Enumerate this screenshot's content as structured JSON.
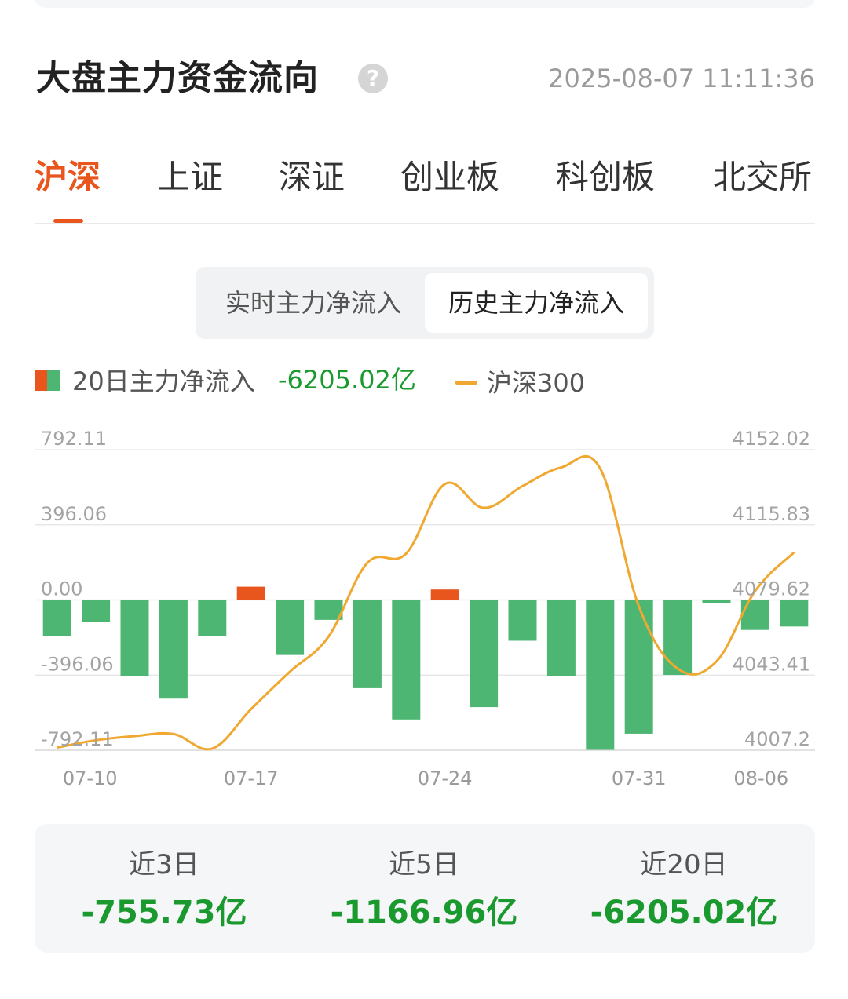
{
  "header": {
    "title": "大盘主力资金流向",
    "help_icon_glyph": "?",
    "timestamp": "2025-08-07 11:11:36"
  },
  "tabs": [
    {
      "label": "沪深",
      "active": true
    },
    {
      "label": "上证",
      "active": false
    },
    {
      "label": "深证",
      "active": false
    },
    {
      "label": "创业板",
      "active": false
    },
    {
      "label": "科创板",
      "active": false
    },
    {
      "label": "北交所",
      "active": false
    }
  ],
  "segmented": {
    "realtime_label": "实时主力净流入",
    "history_label": "历史主力净流入",
    "active": "history"
  },
  "legend": {
    "flow_label": "20日主力净流入",
    "flow_value": "-6205.02亿",
    "index_label": "沪深300"
  },
  "colors": {
    "inflow": "#e8561e",
    "outflow": "#4db673",
    "index_line": "#f0a830",
    "accent": "#e8561e",
    "positive_text_green": "#1a9a2e"
  },
  "chart_data": {
    "type": "bar+line",
    "x": [
      "07-10",
      "07-11",
      "07-14",
      "07-15",
      "07-16",
      "07-17",
      "07-18",
      "07-21",
      "07-22",
      "07-23",
      "07-24",
      "07-25",
      "07-28",
      "07-29",
      "07-30",
      "07-31",
      "08-01",
      "08-04",
      "08-05",
      "08-06"
    ],
    "x_tick_labels": [
      "07-10",
      "07-17",
      "07-24",
      "07-31",
      "08-06"
    ],
    "series": [
      {
        "name": "20日主力净流入",
        "axis": "left",
        "kind": "bar",
        "values": [
          -190,
          -115,
          -400,
          -520,
          -190,
          70,
          -290,
          -105,
          -465,
          -630,
          55,
          -565,
          -215,
          -400,
          -790,
          -705,
          -395,
          -15,
          -158,
          -140
        ]
      },
      {
        "name": "沪深300",
        "axis": "right",
        "kind": "line",
        "values": [
          4008.5,
          4012.0,
          4014.0,
          4015.0,
          4008.0,
          4027.0,
          4045.0,
          4062.0,
          4097.5,
          4102.0,
          4135.5,
          4124.0,
          4134.5,
          4143.5,
          4143.0,
          4076.5,
          4046.5,
          4050.0,
          4084.0,
          4102.5
        ]
      }
    ],
    "left_axis": {
      "ticks": [
        "792.11",
        "396.06",
        "0.00",
        "-396.06",
        "-792.11"
      ],
      "ylim": [
        -792.11,
        792.11
      ]
    },
    "right_axis": {
      "ticks": [
        "4152.02",
        "4115.83",
        "4079.62",
        "4043.41",
        "4007.2"
      ],
      "ylim": [
        4007.2,
        4152.02
      ]
    },
    "grid": true
  },
  "summary": [
    {
      "label": "近3日",
      "value": "-755.73亿"
    },
    {
      "label": "近5日",
      "value": "-1166.96亿"
    },
    {
      "label": "近20日",
      "value": "-6205.02亿"
    }
  ]
}
